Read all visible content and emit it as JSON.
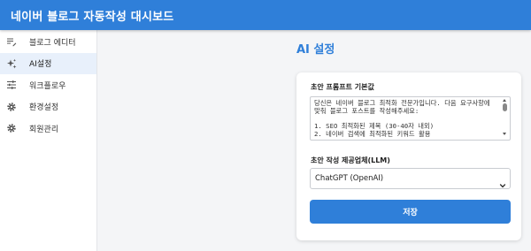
{
  "header": {
    "title": "네이버 블로그 자동작성 대시보드"
  },
  "sidebar": {
    "items": [
      {
        "label": "블로그 에디터",
        "icon": "edit-list-icon",
        "active": false
      },
      {
        "label": "AI설정",
        "icon": "sparkles-icon",
        "active": true
      },
      {
        "label": "워크플로우",
        "icon": "sliders-icon",
        "active": false
      },
      {
        "label": "환경설정",
        "icon": "gear-icon",
        "active": false
      },
      {
        "label": "회원관리",
        "icon": "gear-icon",
        "active": false
      }
    ]
  },
  "main": {
    "title": "AI 설정",
    "prompt_label": "초안 프롬프트 기본값",
    "prompt_value": "당신은 네이버 블로그 최적화 전문가입니다. 다음 요구사항에 맞춰 블로그 포스트를 작성해주세요:\n\n1. SEO 최적화된 제목 (30-40자 내외)\n2. 네이버 검색에 최적화된 키워드 활용",
    "llm_label": "초안 작성 제공업체(LLM)",
    "llm_selected": "ChatGPT (OpenAI)",
    "save_label": "저장"
  },
  "colors": {
    "accent": "#2f7fd9",
    "active_bg": "#e8f0fb",
    "page_bg": "#f4f5f7"
  }
}
